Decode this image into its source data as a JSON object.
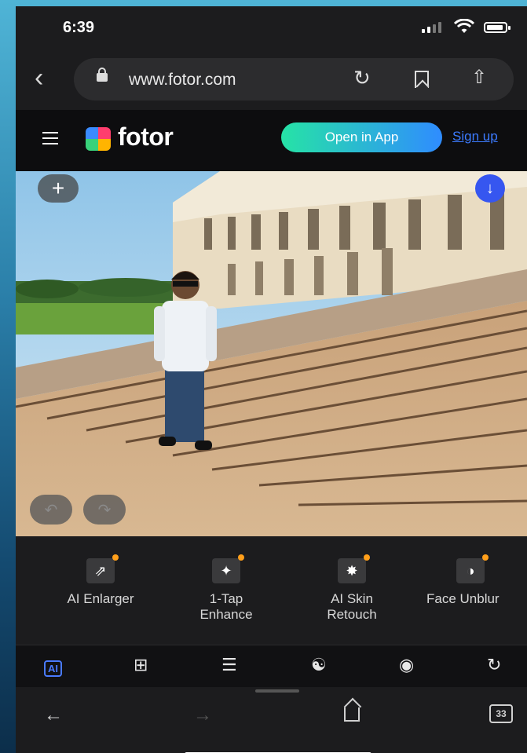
{
  "status_bar": {
    "time": "6:39"
  },
  "browser": {
    "url": "www.fotor.com",
    "tab_count": "33"
  },
  "header": {
    "logo_text": "fotor",
    "open_app_label": "Open in App",
    "signup_label": "Sign up"
  },
  "canvas": {
    "add_icon": "plus-icon",
    "download_icon": "download-icon"
  },
  "tools": [
    {
      "label": "AI Enlarger",
      "icon": "enlarge-icon"
    },
    {
      "label": "1-Tap\nEnhance",
      "icon": "magic-wand-icon"
    },
    {
      "label": "AI Skin\nRetouch",
      "icon": "skin-retouch-icon"
    },
    {
      "label": "Face Unblur",
      "icon": "face-unblur-icon"
    }
  ],
  "colors": {
    "accent": "#3656f0",
    "new_dot": "#ff9f1a",
    "open_app_start": "#26e3a6",
    "open_app_end": "#2f8cff"
  }
}
